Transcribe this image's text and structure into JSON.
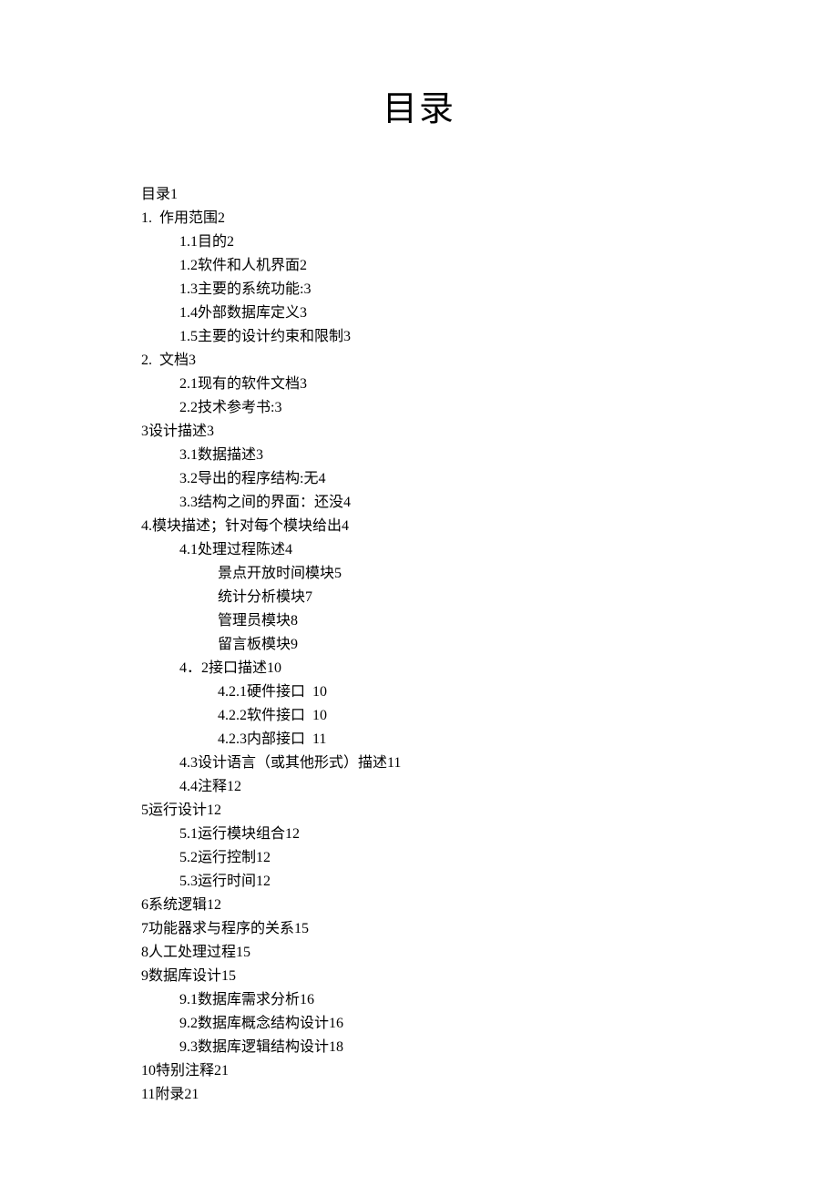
{
  "title": "目录",
  "toc": [
    {
      "level": 0,
      "label": "目录",
      "page": "1"
    },
    {
      "level": 0,
      "label": "1.  作用范围",
      "page": "2"
    },
    {
      "level": 1,
      "label": "1.1目的",
      "page": "2"
    },
    {
      "level": 1,
      "label": "1.2软件和人机界面",
      "page": "2"
    },
    {
      "level": 1,
      "label": "1.3主要的系统功能:",
      "page": "3"
    },
    {
      "level": 1,
      "label": "1.4外部数据库定义",
      "page": "3"
    },
    {
      "level": 1,
      "label": "1.5主要的设计约束和限制",
      "page": "3"
    },
    {
      "level": 0,
      "label": "2.  文档",
      "page": "3"
    },
    {
      "level": 1,
      "label": "2.1现有的软件文档",
      "page": "3"
    },
    {
      "level": 1,
      "label": "2.2技术参考书:",
      "page": "3"
    },
    {
      "level": 0,
      "label": "3设计描述",
      "page": "3"
    },
    {
      "level": 1,
      "label": "3.1数据描述",
      "page": "3"
    },
    {
      "level": 1,
      "label": "3.2导出的程序结构:无",
      "page": "4"
    },
    {
      "level": 1,
      "label": "3.3结构之间的界面：还没",
      "page": "4"
    },
    {
      "level": 0,
      "label": "4.模块描述；针对每个模块给出",
      "page": "4"
    },
    {
      "level": 1,
      "label": "4.1处理过程陈述",
      "page": "4"
    },
    {
      "level": 2,
      "label": "景点开放时间模块",
      "page": "5"
    },
    {
      "level": 2,
      "label": "统计分析模块",
      "page": "7"
    },
    {
      "level": 2,
      "label": "管理员模块",
      "page": "8"
    },
    {
      "level": 2,
      "label": "留言板模块",
      "page": "9"
    },
    {
      "level": 1,
      "label": "4．2接口描述",
      "page": "10"
    },
    {
      "level": 2,
      "label": "4.2.1硬件接口  ",
      "page": "10"
    },
    {
      "level": 2,
      "label": "4.2.2软件接口  ",
      "page": "10"
    },
    {
      "level": 2,
      "label": "4.2.3内部接口  ",
      "page": "11"
    },
    {
      "level": 1,
      "label": "4.3设计语言（或其他形式）描述",
      "page": "11"
    },
    {
      "level": 1,
      "label": "4.4注释",
      "page": "12"
    },
    {
      "level": 0,
      "label": "5运行设计",
      "page": "12"
    },
    {
      "level": 1,
      "label": "5.1运行模块组合",
      "page": "12"
    },
    {
      "level": 1,
      "label": "5.2运行控制",
      "page": "12"
    },
    {
      "level": 1,
      "label": "5.3运行时间",
      "page": "12"
    },
    {
      "level": 0,
      "label": "6系统逻辑",
      "page": "12"
    },
    {
      "level": 0,
      "label": "7功能器求与程序的关系",
      "page": "15"
    },
    {
      "level": 0,
      "label": "8人工处理过程",
      "page": "15"
    },
    {
      "level": 0,
      "label": "9数据库设计",
      "page": "15"
    },
    {
      "level": 1,
      "label": "9.1数据库需求分析",
      "page": "16"
    },
    {
      "level": 1,
      "label": "9.2数据库概念结构设计",
      "page": "16"
    },
    {
      "level": 1,
      "label": "9.3数据库逻辑结构设计",
      "page": "18"
    },
    {
      "level": 0,
      "label": "10特别注释",
      "page": "21"
    },
    {
      "level": 0,
      "label": "11附录",
      "page": "21"
    }
  ]
}
